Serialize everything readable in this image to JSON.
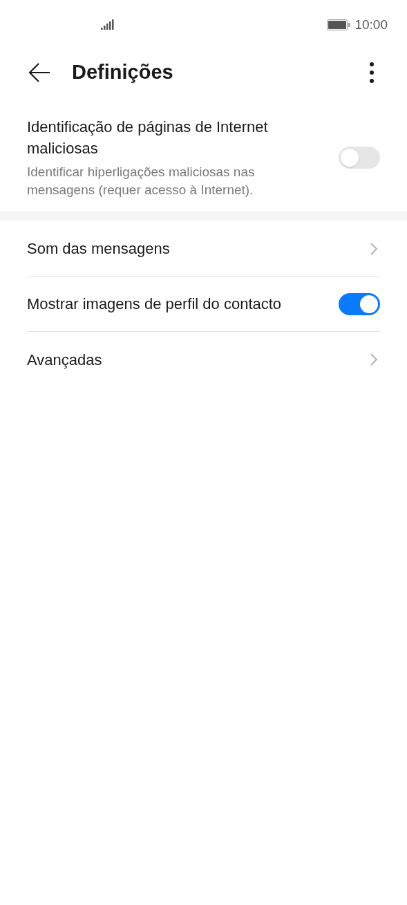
{
  "status_bar": {
    "time": "10:00"
  },
  "header": {
    "title": "Definições"
  },
  "sections": [
    {
      "items": [
        {
          "kind": "toggle",
          "label": "Identificação de páginas de Internet maliciosas",
          "description": "Identificar hiperligações maliciosas nas mensagens (requer acesso à Internet).",
          "on": false
        }
      ]
    },
    {
      "items": [
        {
          "kind": "link",
          "label": "Som das mensagens"
        },
        {
          "kind": "toggle",
          "label": "Mostrar imagens de perfil do contacto",
          "on": true
        },
        {
          "kind": "link",
          "label": "Avançadas"
        }
      ]
    }
  ]
}
